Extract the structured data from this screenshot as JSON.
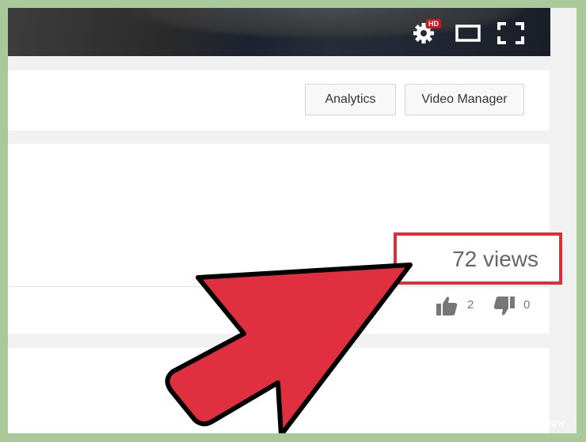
{
  "player": {
    "hd_badge": "HD",
    "controls": [
      {
        "name": "settings",
        "icon": "gear-icon"
      },
      {
        "name": "theater",
        "icon": "theater-mode-icon"
      },
      {
        "name": "fullscreen",
        "icon": "fullscreen-icon"
      }
    ]
  },
  "actions": {
    "analytics_label": "Analytics",
    "video_manager_label": "Video Manager"
  },
  "stats": {
    "views": "72 views",
    "likes": "2",
    "dislikes": "0"
  },
  "highlight_color": "#d9303c",
  "arrow_color": "#e03040",
  "watermark": {
    "part1": "wiki",
    "part2": "How"
  }
}
